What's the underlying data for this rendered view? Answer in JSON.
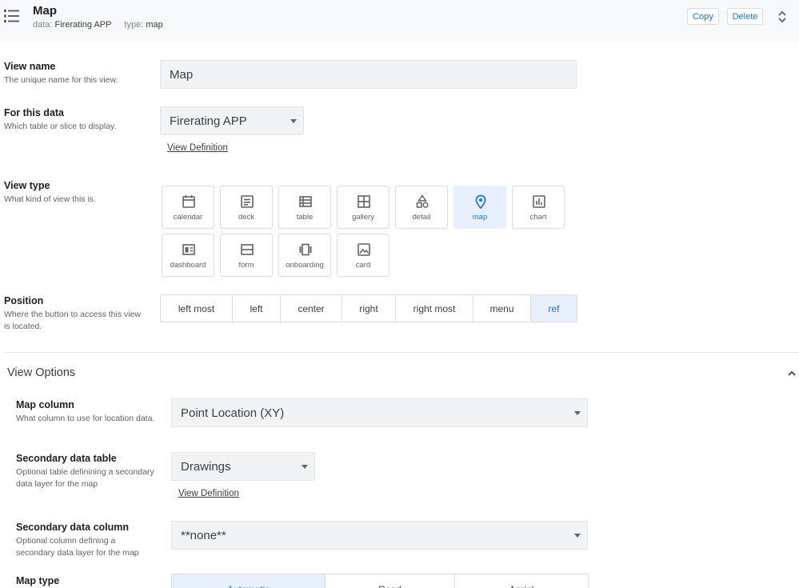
{
  "header": {
    "title": "Map",
    "data_label": "data:",
    "data_value": "Firerating APP",
    "type_label": "type:",
    "type_value": "map",
    "copy_label": "Copy",
    "delete_label": "Delete",
    "icons": {
      "menu": "list-menu-icon",
      "expand": "unfold-chevron-icon"
    }
  },
  "view_name": {
    "label": "View name",
    "description": "The unique name for this view.",
    "value": "Map"
  },
  "for_this_data": {
    "label": "For this data",
    "description": "Which table or slice to display.",
    "value": "Firerating APP",
    "link": "View Definition"
  },
  "view_type": {
    "label": "View type",
    "description": "What kind of view this is.",
    "options": [
      {
        "label": "calendar",
        "icon": "calendar-icon"
      },
      {
        "label": "deck",
        "icon": "deck-icon"
      },
      {
        "label": "table",
        "icon": "table-icon"
      },
      {
        "label": "gallery",
        "icon": "gallery-icon"
      },
      {
        "label": "detail",
        "icon": "detail-icon"
      },
      {
        "label": "map",
        "icon": "map-pin-icon"
      },
      {
        "label": "chart",
        "icon": "chart-icon"
      },
      {
        "label": "dashboard",
        "icon": "dashboard-icon"
      },
      {
        "label": "form",
        "icon": "form-icon"
      },
      {
        "label": "onboarding",
        "icon": "onboarding-icon"
      },
      {
        "label": "card",
        "icon": "card-icon"
      }
    ],
    "selected": "map"
  },
  "position": {
    "label": "Position",
    "description": "Where the button to access this view is located.",
    "options": [
      "left most",
      "left",
      "center",
      "right",
      "right most",
      "menu",
      "ref"
    ],
    "selected": "ref"
  },
  "view_options": {
    "title": "View Options",
    "icon": "chevron-up-icon",
    "map_column": {
      "label": "Map column",
      "description": "What column to use for location data.",
      "value": "Point Location (XY)"
    },
    "secondary_data_table": {
      "label": "Secondary data table",
      "description": "Optional table definining a secondary data layer for the map",
      "value": "Drawings",
      "link": "View Definition"
    },
    "secondary_data_column": {
      "label": "Secondary data column",
      "description": "Optional column defining a secondary data layer for the map",
      "value": "**none**"
    },
    "map_type": {
      "label": "Map type",
      "options": [
        "Automatic",
        "Road",
        "Aerial"
      ],
      "selected": "Automatic"
    }
  },
  "colors": {
    "accent": "#1a73e8",
    "selected_bg": "#e8f0fe",
    "field_bg": "#f1f3f4",
    "header_bg": "#f8f9fa"
  }
}
